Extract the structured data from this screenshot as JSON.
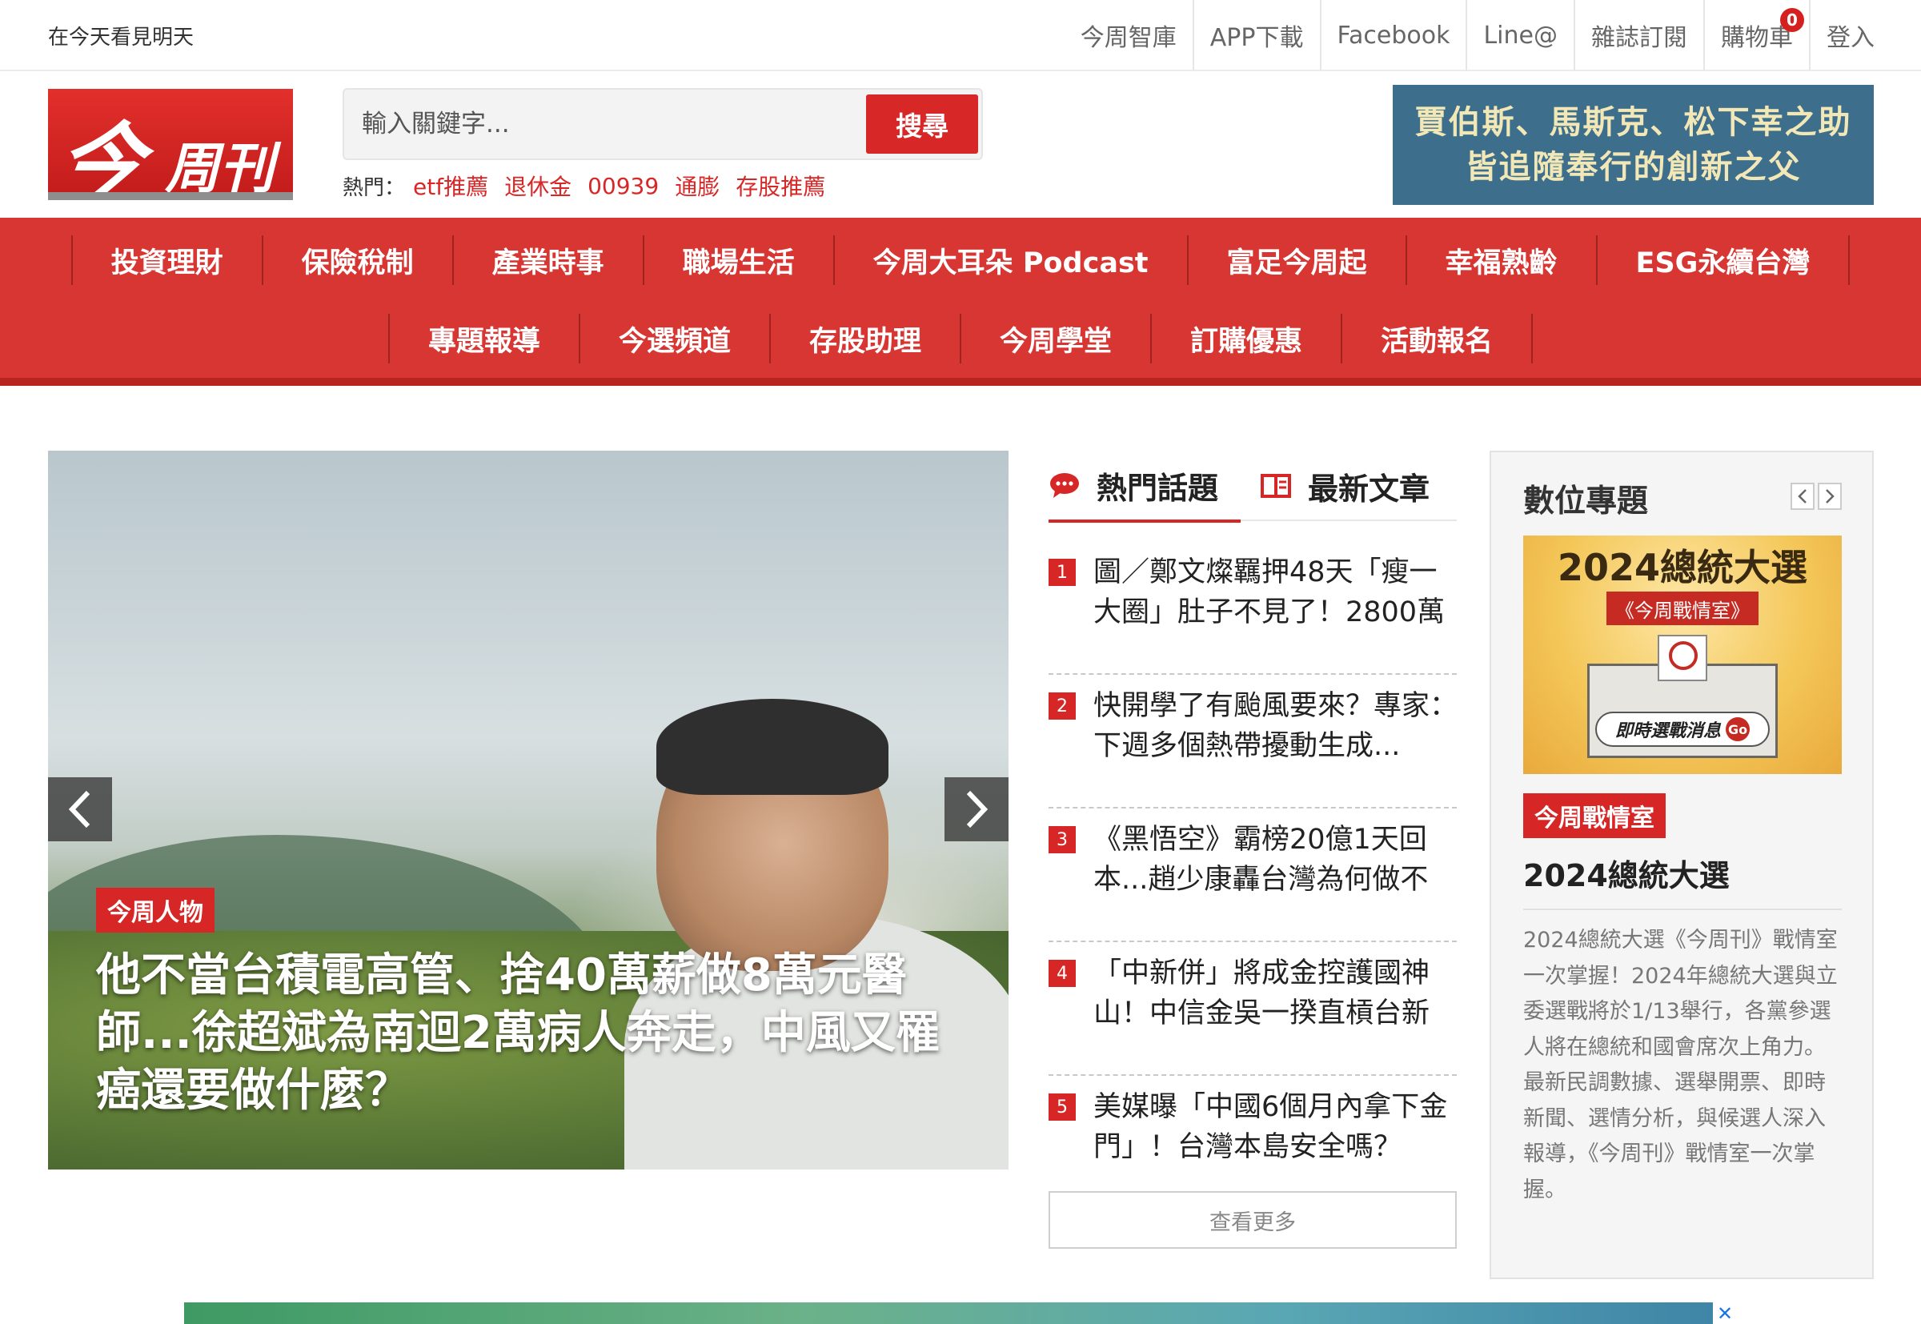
{
  "topbar": {
    "slogan": "在今天看見明天",
    "links": [
      "今周智庫",
      "APP下載",
      "Facebook",
      "Line@",
      "雜誌訂閱",
      "購物車",
      "登入"
    ],
    "cart_count": "0"
  },
  "logo": {
    "big": "今",
    "small": "周刊"
  },
  "search": {
    "placeholder": "輸入關鍵字...",
    "button_label": "搜尋",
    "hot_label": "熱門：",
    "hot_tags": [
      "etf推薦",
      "退休金",
      "00939",
      "通膨",
      "存股推薦"
    ]
  },
  "banner_ad": {
    "line1": "賈伯斯、馬斯克、松下幸之助",
    "line2": "皆追隨奉行的創新之父"
  },
  "nav": {
    "row1": [
      "投資理財",
      "保險稅制",
      "產業時事",
      "職場生活",
      "今周大耳朵 Podcast",
      "富足今周起",
      "幸福熟齡",
      "ESG永續台灣"
    ],
    "row2": [
      "專題報導",
      "今選頻道",
      "存股助理",
      "今周學堂",
      "訂購優惠",
      "活動報名"
    ]
  },
  "hero": {
    "tag": "今周人物",
    "title": "他不當台積電高管、捨40萬薪做8萬元醫師...徐超斌為南迴2萬病人奔走，中風又罹癌還要做什麼？"
  },
  "tabs": {
    "hot_topics": "熱門話題",
    "latest": "最新文章"
  },
  "hot_list": [
    {
      "num": "1",
      "text": "圖／鄭文燦羈押48天「瘦一大圈」肚子不見了！2800萬"
    },
    {
      "num": "2",
      "text": "快開學了有颱風要來？專家：下週多個熱帶擾動生成..."
    },
    {
      "num": "3",
      "text": "《黑悟空》霸榜20億1天回本...趙少康轟台灣為何做不"
    },
    {
      "num": "4",
      "text": "「中新併」將成金控護國神山！中信金吳一揆直槓台新"
    },
    {
      "num": "5",
      "text": "美媒曝「中國6個月內拿下金門」！台灣本島安全嗎？"
    }
  ],
  "more_label": "查看更多",
  "digital": {
    "title": "數位專題",
    "image_headline": "2024總統大選",
    "image_ribbon": "《今周戰情室》",
    "image_button": "即時選戰消息",
    "image_go": "Go",
    "tag": "今周戰情室",
    "headline": "2024總統大選",
    "description": "2024總統大選《今周刊》戰情室一次掌握！2024年總統大選與立委選戰將於1/13舉行，各黨參選人將在總統和國會席次上角力。最新民調數據、選舉開票、即時新聞、選情分析，與候選人深入報導，《今周刊》戰情室一次掌握。"
  },
  "colors": {
    "brand_red": "#d72626",
    "nav_red": "#d73632",
    "ad_blue": "#3d6e8b"
  }
}
